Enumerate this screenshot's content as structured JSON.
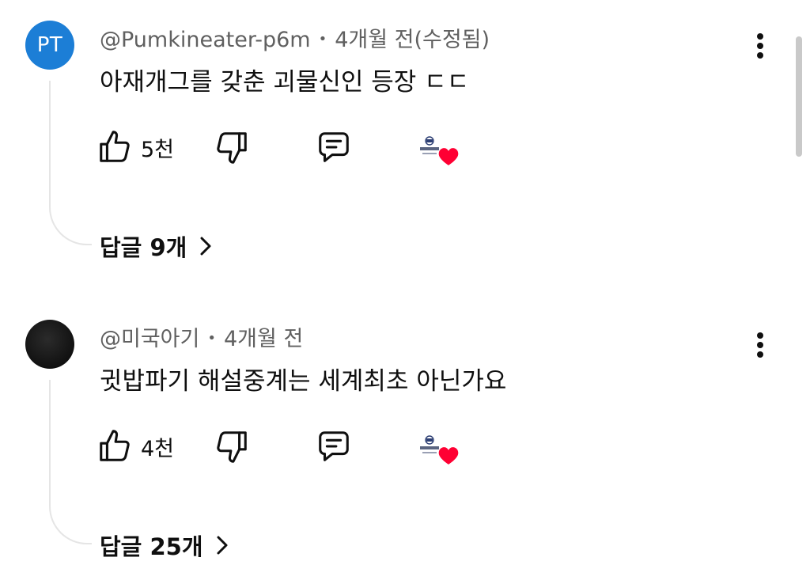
{
  "comments": [
    {
      "avatar_initials": "PT",
      "avatar_color": "#1c7ed6",
      "author": "@Pumkineater-p6m",
      "separator": "•",
      "time": "4개월 전(수정됨)",
      "text": "아재개그를 갖춘 괴물신인 등장 ㄷㄷ",
      "like_count": "5천",
      "replies_label": "답글 9개",
      "creator_heart": true
    },
    {
      "avatar_initials": "",
      "avatar_color": "#111111",
      "author": "@미국아기",
      "separator": "•",
      "time": "4개월 전",
      "text": "귓밥파기 해설중계는 세계최초 아닌가요",
      "like_count": "4천",
      "replies_label": "답글 25개",
      "creator_heart": true
    }
  ],
  "icons": {
    "like": "thumb-up-icon",
    "dislike": "thumb-down-icon",
    "reply": "comment-icon",
    "more": "more-vertical-icon",
    "chevron": "chevron-right-icon",
    "heart": "heart-icon"
  },
  "colors": {
    "heart": "#ff0033",
    "meta_text": "#606060",
    "thread_line": "#e5e5e5"
  }
}
